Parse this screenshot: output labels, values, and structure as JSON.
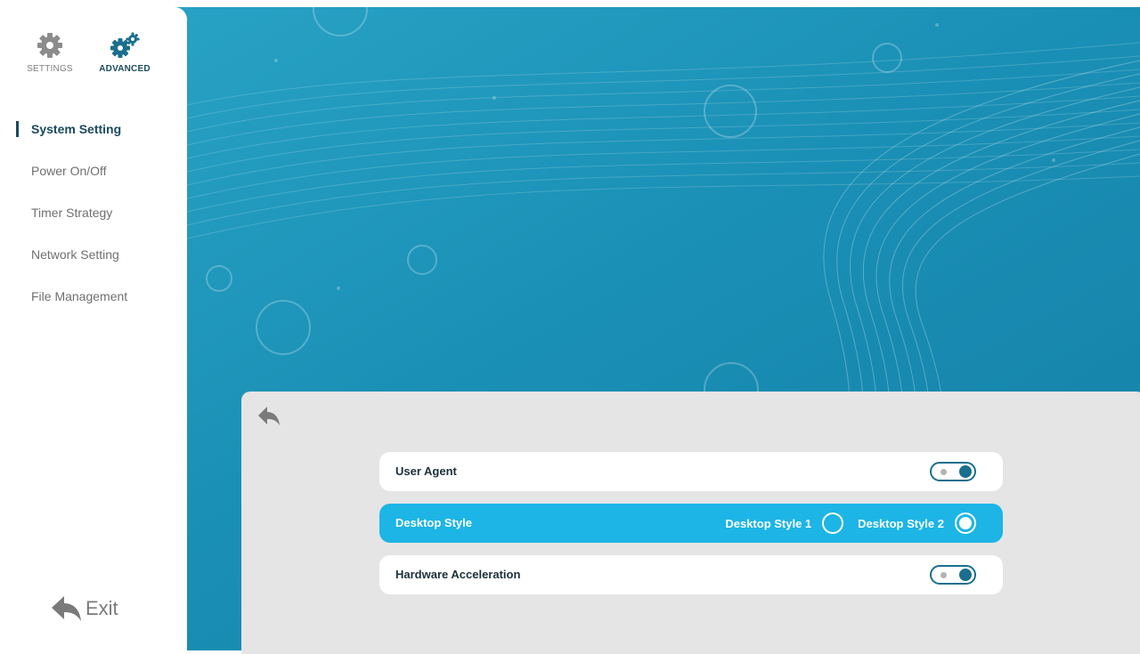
{
  "tabs": {
    "settings": "SETTINGS",
    "advanced": "ADVANCED"
  },
  "menu": {
    "items": [
      "System Setting",
      "Power On/Off",
      "Timer Strategy",
      "Network Setting",
      "File Management"
    ],
    "active": "System Setting"
  },
  "exit_label": "Exit",
  "panel": {
    "rows": [
      {
        "label": "User Agent",
        "control": "toggle",
        "value": "on"
      },
      {
        "label": "Desktop Style",
        "control": "radio",
        "options": [
          "Desktop Style 1",
          "Desktop Style 2"
        ],
        "selected": "Desktop Style 2"
      },
      {
        "label": "Hardware Acceleration",
        "control": "toggle",
        "value": "on"
      }
    ]
  },
  "icons": {
    "settings_tab": "gear-icon",
    "advanced_tab": "gears-icon",
    "back": "back-arrow-icon",
    "exit": "back-arrow-icon"
  },
  "colors": {
    "background_teal": "#1a8fb5",
    "accent_blue": "#1cb5e5",
    "toggle_dark": "#1a6f8e",
    "panel_gray": "#e5e5e5",
    "active_text": "#1a4a5e"
  }
}
